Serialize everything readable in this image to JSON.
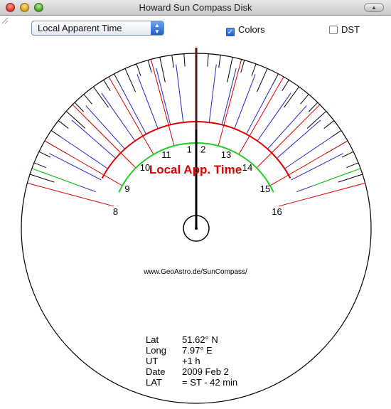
{
  "window": {
    "title": "Howard Sun Compass Disk"
  },
  "toolbar": {
    "time_mode": "Local Apparent Time",
    "colors_label": "Colors",
    "colors_checked": true,
    "dst_label": "DST",
    "dst_checked": false
  },
  "disk": {
    "center_label": "Local App. Time",
    "url": "www.GeoAstro.de/SunCompass/",
    "hour_labels": [
      "8",
      "9",
      "10",
      "11",
      "1",
      "2",
      "13",
      "14",
      "15",
      "16"
    ],
    "colors": {
      "hour_arc": "#dd0000",
      "inner_arc": "#22cc22",
      "blue_ticks": "#2222cc",
      "gnomon": "#000000"
    }
  },
  "info": {
    "rows": [
      {
        "key": "Lat",
        "value": "51.62° N"
      },
      {
        "key": "Long",
        "value": "7.97° E"
      },
      {
        "key": "UT",
        "value": "+1 h"
      },
      {
        "key": "Date",
        "value": "2009 Feb 2"
      },
      {
        "key": "LAT",
        "value": "= ST - 42 min"
      }
    ]
  }
}
